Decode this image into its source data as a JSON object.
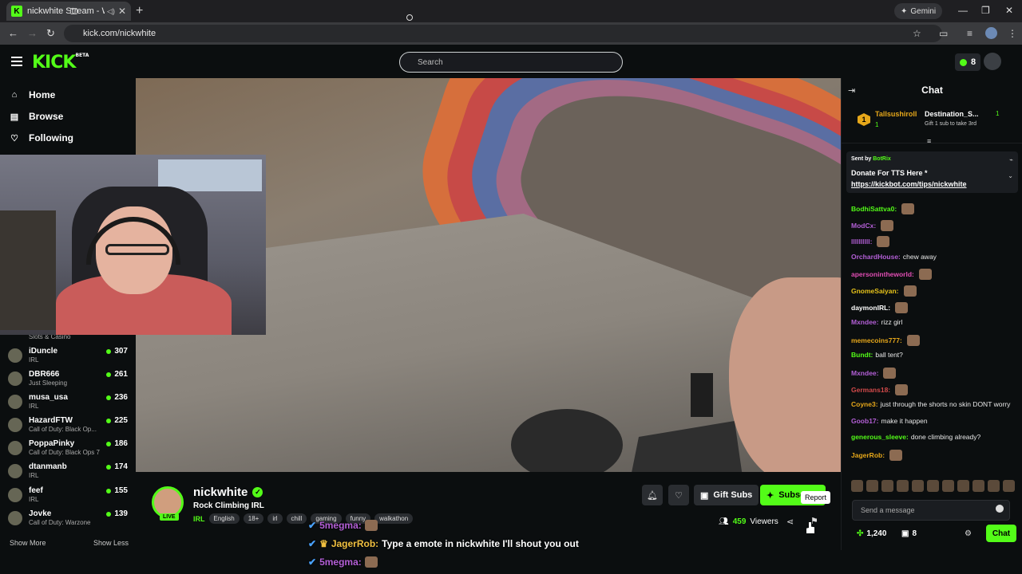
{
  "browser": {
    "tab_title": "nickwhite Stream - Watch L",
    "tab_icon": "kick-favicon",
    "gemini_label": "Gemini",
    "url": "kick.com/nickwhite"
  },
  "header": {
    "logo_text": "KICK",
    "logo_badge": "BETA",
    "search_placeholder": "Search",
    "kicks_count": "8"
  },
  "sidebar": {
    "nav": [
      {
        "label": "Home",
        "icon": "home-icon"
      },
      {
        "label": "Browse",
        "icon": "browse-icon"
      },
      {
        "label": "Following",
        "icon": "heart-icon"
      }
    ],
    "partial_category": "Slots & Casino",
    "streamers": [
      {
        "name": "iDuncle",
        "category": "IRL",
        "viewers": "307"
      },
      {
        "name": "DBR666",
        "category": "Just Sleeping",
        "viewers": "261"
      },
      {
        "name": "musa_usa",
        "category": "IRL",
        "viewers": "236"
      },
      {
        "name": "HazardFTW",
        "category": "Call of Duty: Black Op...",
        "viewers": "225"
      },
      {
        "name": "PoppaPinky",
        "category": "Call of Duty: Black Ops 7",
        "viewers": "186"
      },
      {
        "name": "dtanmanb",
        "category": "IRL",
        "viewers": "174"
      },
      {
        "name": "feef",
        "category": "IRL",
        "viewers": "155"
      },
      {
        "name": "Jovke",
        "category": "Call of Duty: Warzone",
        "viewers": "139"
      }
    ],
    "show_more": "Show More",
    "show_less": "Show Less"
  },
  "stream": {
    "channel_name": "nickwhite",
    "live_label": "LIVE",
    "title": "Rock Climbing IRL",
    "category": "IRL",
    "tags": [
      "English",
      "18+",
      "irl",
      "chill",
      "gaming",
      "funny",
      "walkathon"
    ],
    "gift_subs_label": "Gift Subs",
    "subscribe_label": "Subscribe",
    "tooltip": "Report",
    "viewers": "459",
    "viewers_label": "Viewers"
  },
  "overlay_chat": [
    {
      "user": "5megma:",
      "text": ""
    },
    {
      "user": "JagerRob:",
      "text": "Type a emote in nickwhite I'll shout you out"
    },
    {
      "user": "5megma:",
      "text": ""
    }
  ],
  "chat": {
    "title": "Chat",
    "leaderboard": {
      "rank": "1",
      "first_name": "Tallsushiroll",
      "first_count": "1",
      "second_name": "Destination_S...",
      "second_count": "1",
      "second_text": "Gift 1 sub to take 3rd"
    },
    "pinned": {
      "sent_by": "Sent by",
      "bot_name": "BotRix",
      "line1": "Donate For TTS Here *",
      "line2": "https://kickbot.com/tips/nickwhite"
    },
    "messages": [
      {
        "user": "BodhiSattva0:",
        "text": "",
        "color": "#53fc18"
      },
      {
        "user": "ModCx:",
        "text": "",
        "color": "#b35fd6"
      },
      {
        "user": "llllllllll:",
        "text": "",
        "color": "#b35fd6"
      },
      {
        "user": "OrchardHouse:",
        "text": "chew away",
        "color": "#b35fd6"
      },
      {
        "user": "apersonintheworld:",
        "text": "",
        "color": "#e04db3"
      },
      {
        "user": "GnomeSaiyan:",
        "text": "",
        "color": "#e6c21a"
      },
      {
        "user": "daymonIRL:",
        "text": "",
        "color": "#ffffff"
      },
      {
        "user": "Mxndee:",
        "text": "rizz girl",
        "color": "#b35fd6"
      },
      {
        "user": "memecoins777:",
        "text": "",
        "color": "#e6a71a"
      },
      {
        "user": "Bundt:",
        "text": "ball tent?",
        "color": "#53fc18"
      },
      {
        "user": "Mxndee:",
        "text": "",
        "color": "#b35fd6"
      },
      {
        "user": "Germans18:",
        "text": "",
        "color": "#d24a4a"
      },
      {
        "user": "Coyne3:",
        "text": "just through the shorts no skin DONT worry",
        "color": "#e6a71a"
      },
      {
        "user": "Goob17:",
        "text": "make it happen",
        "color": "#b35fd6"
      },
      {
        "user": "generous_sleeve:",
        "text": "done climbing already?",
        "color": "#53fc18"
      },
      {
        "user": "JagerRob:",
        "text": "",
        "color": "#e6a71a"
      }
    ],
    "input_placeholder": "Send a message",
    "points": "1,240",
    "gift_count": "8",
    "send_label": "Chat"
  }
}
